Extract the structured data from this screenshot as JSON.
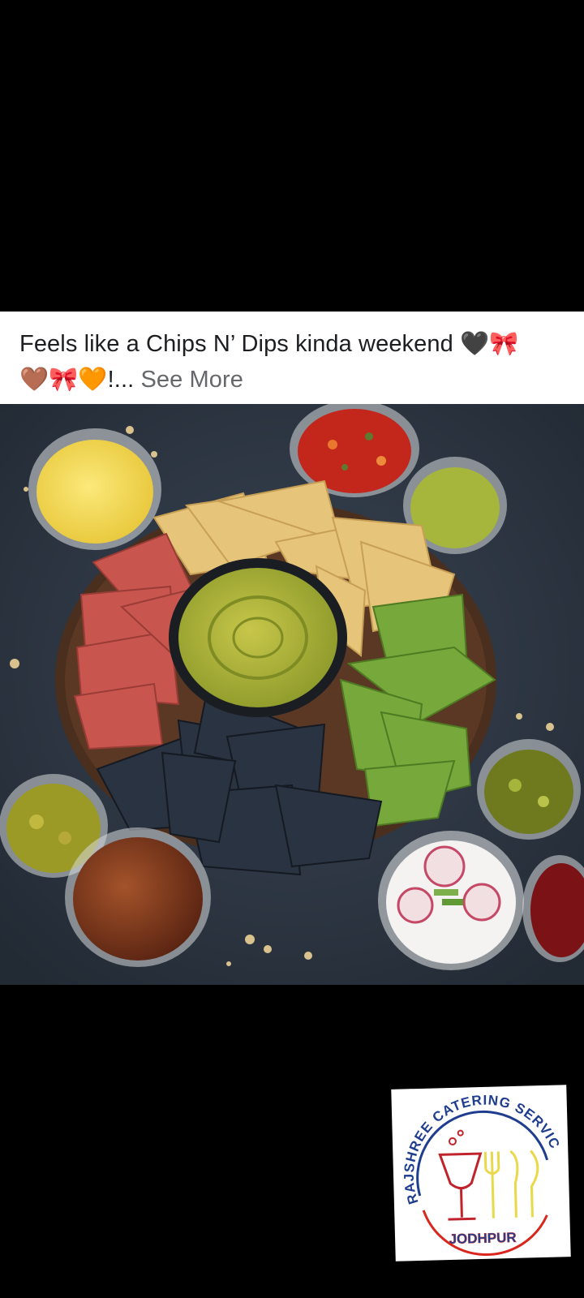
{
  "post": {
    "caption_line1": "Feels like a Chips N’ Dips kinda weekend 🖤🎀",
    "caption_line2_emoji": "🤎🎀🧡",
    "caption_ellipsis": "!... ",
    "see_more_label": "See More"
  },
  "photo": {
    "subject": "Chips and dips platter"
  },
  "logo": {
    "company_name": "RAJSHREE CATERING SERVICE",
    "city": "JODHPUR",
    "colors": {
      "ring": "#d9271d",
      "ring_blue": "#1f3d8f",
      "cutlery": "#e9d949",
      "glass": "#c0232b"
    }
  }
}
